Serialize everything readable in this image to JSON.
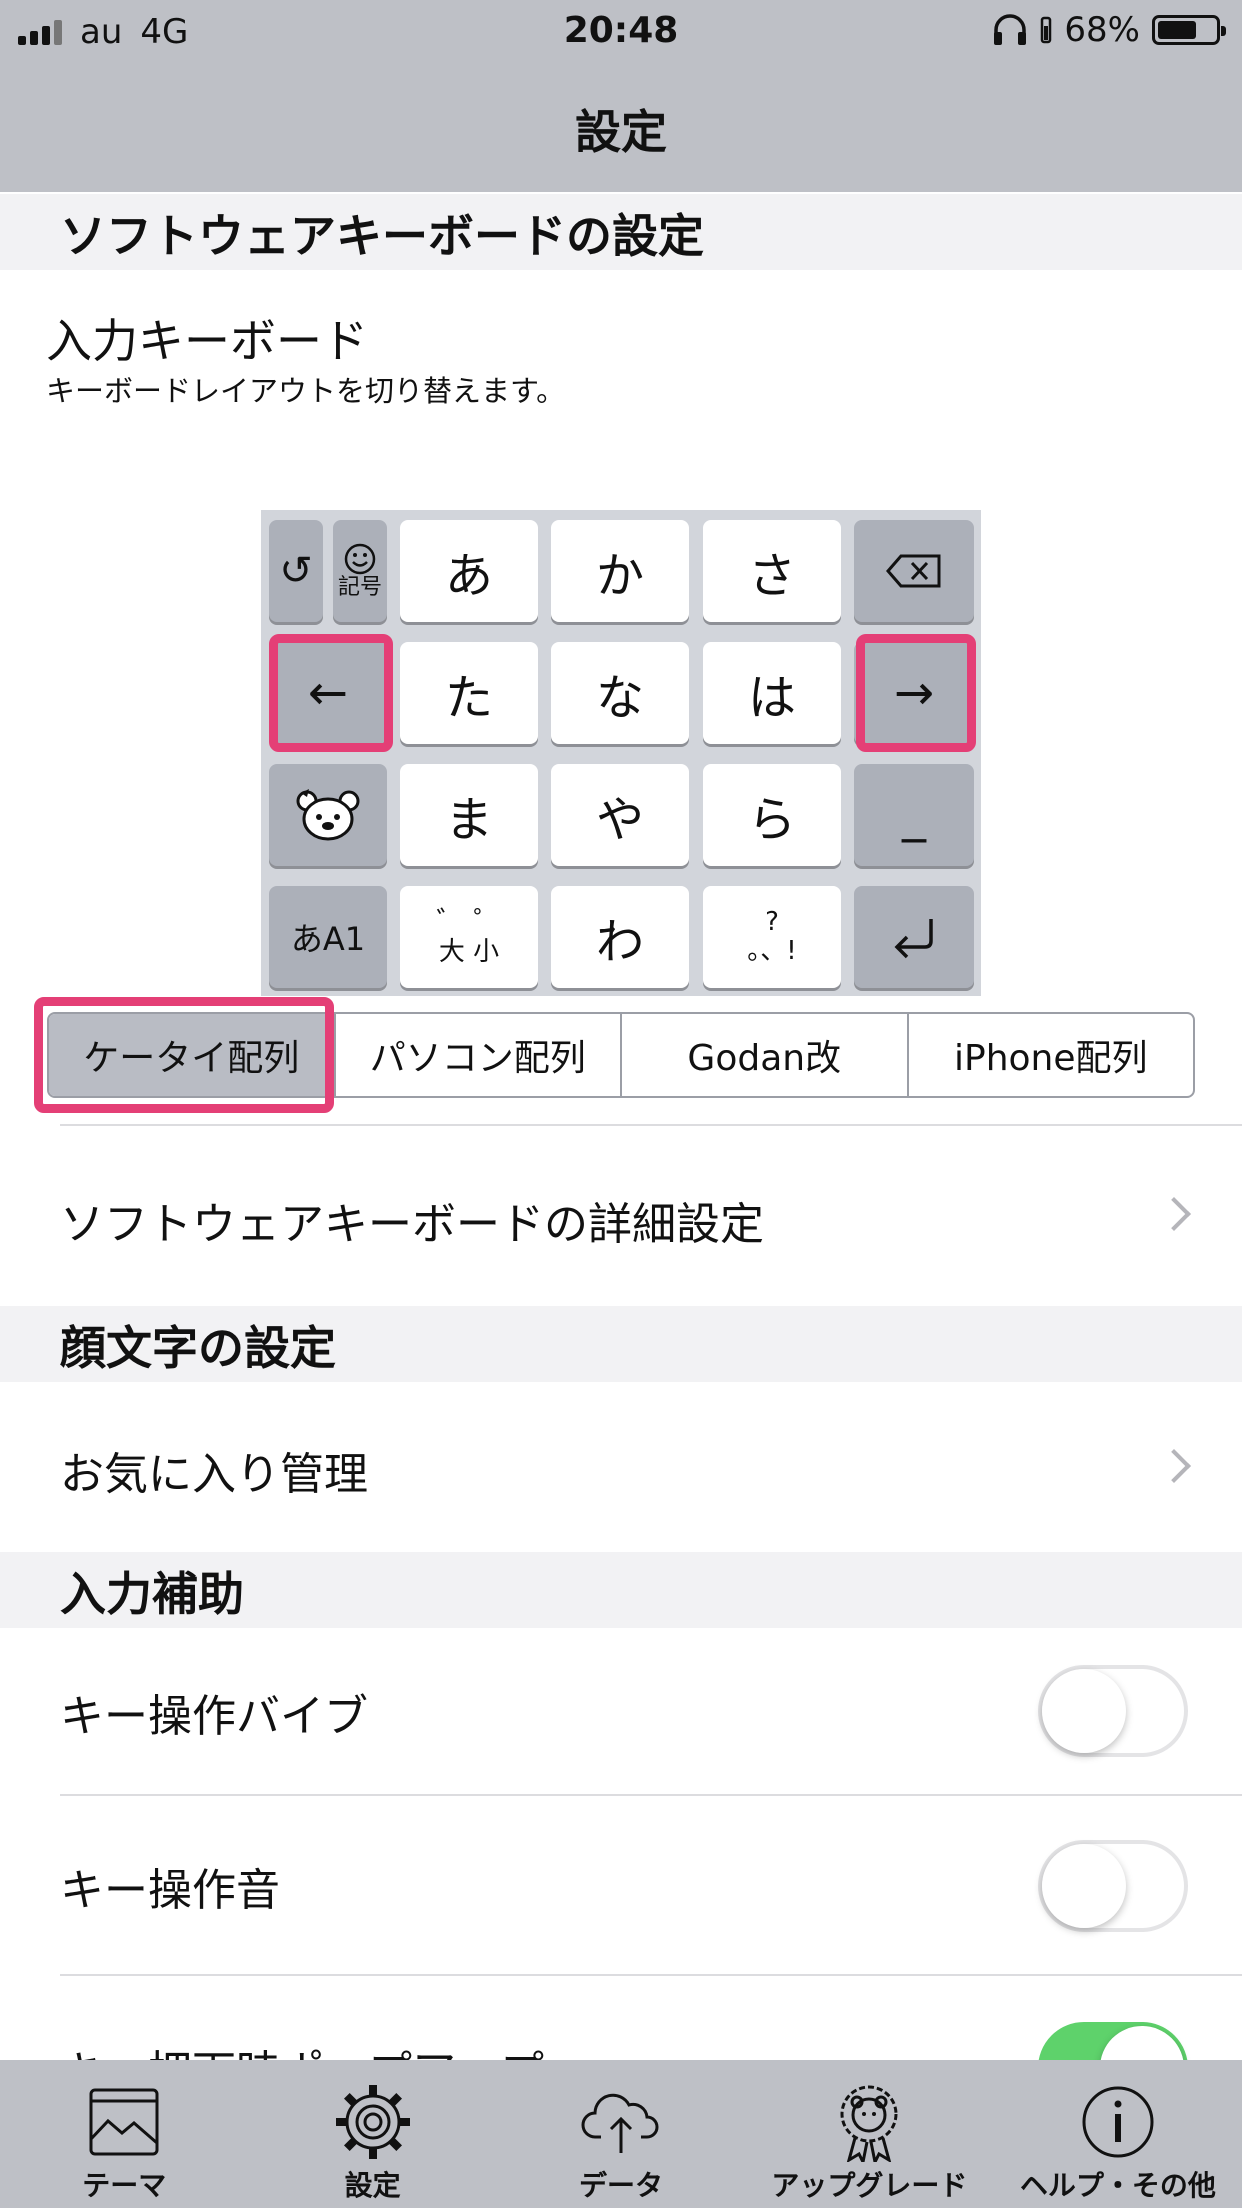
{
  "status": {
    "carrier": "au",
    "network": "4G",
    "time": "20:48",
    "battery": "68%",
    "battery_level": 0.68
  },
  "nav": {
    "title": "設定"
  },
  "software_keyboard": {
    "section_title": "ソフトウェアキーボードの設定",
    "input_keyboard_title": "入力キーボード",
    "input_keyboard_desc": "キーボードレイアウトを切り替えます。",
    "keys": {
      "row1": [
        "あ",
        "か",
        "さ"
      ],
      "row2": [
        "た",
        "な",
        "は"
      ],
      "row3": [
        "ま",
        "や",
        "ら"
      ],
      "row4": [
        "わ"
      ],
      "left_arrow": "←",
      "right_arrow": "→",
      "undo": "↺",
      "symbols": "記号",
      "mode": "あA1",
      "underscore": "_",
      "dakuten_top": "゛ ゜",
      "dakuten_bottom": "大 小",
      "punct_top": "?",
      "punct_bottom": "。、!",
      "delete_icon": "delete-icon",
      "return_icon": "return-icon"
    },
    "layouts": [
      "ケータイ配列",
      "パソコン配列",
      "Godan改",
      "iPhone配列"
    ],
    "selected_layout": "ケータイ配列",
    "detail_settings": "ソフトウェアキーボードの詳細設定"
  },
  "kaomoji": {
    "section_title": "顔文字の設定",
    "favorites": "お気に入り管理"
  },
  "input_assist": {
    "section_title": "入力補助",
    "vibration": {
      "label": "キー操作バイブ",
      "on": false
    },
    "sound": {
      "label": "キー操作音",
      "on": false
    },
    "popup": {
      "label": "キー押下時ポップアップ",
      "on": true
    }
  },
  "tabs": [
    {
      "label": "テーマ",
      "icon": "theme-image-icon"
    },
    {
      "label": "設定",
      "icon": "gear-icon"
    },
    {
      "label": "データ",
      "icon": "cloud-upload-icon"
    },
    {
      "label": "アップグレード",
      "icon": "bear-badge-icon"
    },
    {
      "label": "ヘルプ・その他",
      "icon": "info-icon"
    }
  ],
  "colors": {
    "highlight": "#e43f76",
    "toggle_on": "#5ed26b",
    "bar": "#bec0c6"
  }
}
